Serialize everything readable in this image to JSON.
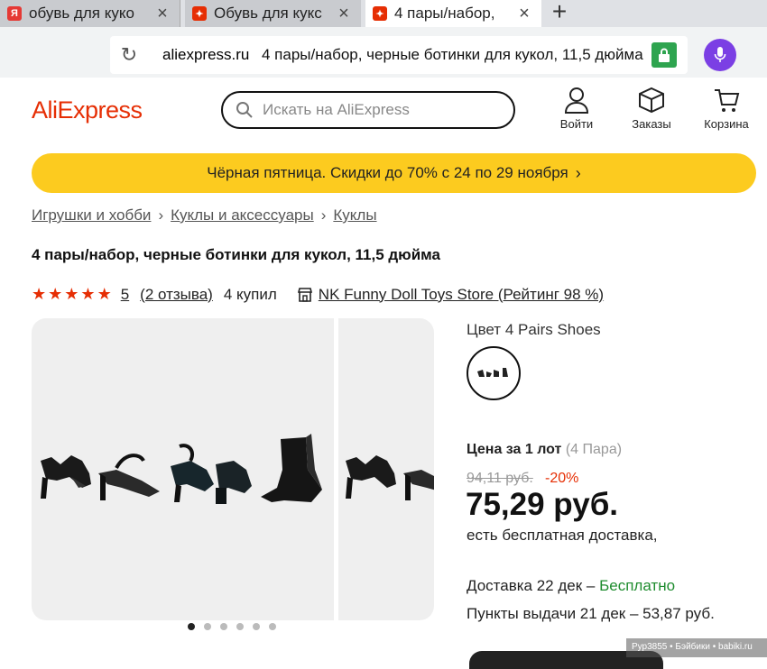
{
  "browser": {
    "tabs": [
      {
        "label": "обувь для куко",
        "favicon": "yandex-icon"
      },
      {
        "label": "Обувь для кукс",
        "favicon": "aliexpress-icon"
      },
      {
        "label": "4 пары/набор,",
        "favicon": "aliexpress-icon"
      }
    ],
    "domain": "aliexpress.ru",
    "url_title": "4 пары/набор, черные ботинки для кукол, 11,5 дюйма"
  },
  "header": {
    "logo": "AliExpress",
    "search_placeholder": "Искать на AliExpress",
    "nav": [
      {
        "label": "Войти",
        "icon": "user-icon"
      },
      {
        "label": "Заказы",
        "icon": "box-icon"
      },
      {
        "label": "Корзина",
        "icon": "cart-icon"
      }
    ]
  },
  "promo": {
    "text": "Чёрная пятница. Скидки до 70% с 24 по 29 ноября"
  },
  "breadcrumbs": [
    "Игрушки и хобби",
    "Куклы и аксессуары",
    "Куклы"
  ],
  "product": {
    "title": "4 пары/набор, черные ботинки для кукол, 11,5 дюйма",
    "rating_value": "5",
    "stars": 5,
    "reviews": "(2 отзыва)",
    "purchases": "4 купил",
    "store": "NK Funny Doll Toys Store (Рейтинг 98 %)",
    "gallery_dots": 6,
    "gallery_active": 1
  },
  "options": {
    "color_label": "Цвет 4 Pairs Shoes"
  },
  "price": {
    "lot_label": "Цена за 1 лот",
    "lot_qty": "(4 Пара)",
    "old": "94,11 руб.",
    "discount": "-20%",
    "current": "75,29 руб.",
    "free_shipping": "есть бесплатная доставка,"
  },
  "delivery": {
    "label": "Доставка 22 дек –",
    "free": "Бесплатно",
    "pickup": "Пункты выдачи 21 дек – 53,87 руб."
  },
  "watermark": "Рур3855 • Бэйбики • babiki.ru",
  "colors": {
    "brand": "#e62e04",
    "promo": "#fccb1f",
    "free": "#1e8c2e",
    "mic": "#7b3fe4"
  }
}
